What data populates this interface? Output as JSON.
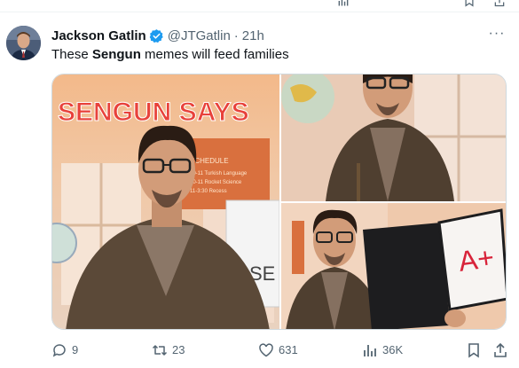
{
  "tweet": {
    "author_name": "Jackson Gatlin",
    "handle": "@JTGatlin",
    "separator": "·",
    "time": "21h",
    "text_before": "These ",
    "text_bold": "Sengun",
    "text_after": " memes will feed families",
    "more_label": "···"
  },
  "media": {
    "sign_text": "SENGUN SAYS",
    "schedule_title": "SCHEDULE",
    "schedule_lines": [
      "10-11 Turkish Language",
      "10-11 Rocket Science",
      "11-3:30 Recess"
    ],
    "board_text": "SE",
    "grade_text": "A+"
  },
  "actions": {
    "replies": "9",
    "reposts": "23",
    "likes": "631",
    "views": "36K"
  },
  "colors": {
    "text": "#0f1419",
    "secondary": "#536471",
    "verified": "#1d9bf0",
    "border": "#cfd9de"
  }
}
